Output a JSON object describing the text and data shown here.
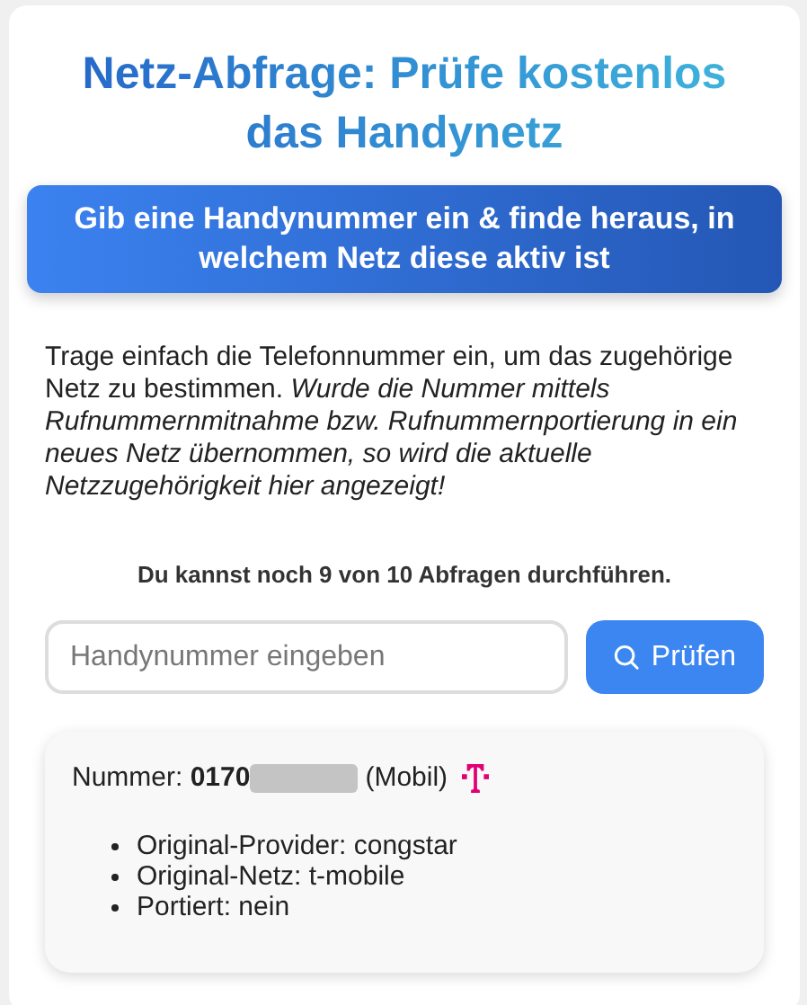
{
  "title": "Netz-Abfrage: Prüfe kostenlos das Handynetz",
  "banner": "Gib eine Handynummer ein & finde heraus, in welchem Netz diese aktiv ist",
  "intro": "Trage einfach die Telefonnummer ein, um das zugehörige Netz zu bestimmen. *Wurde die Nummer mittels Rufnummernmitnahme bzw. Rufnummernportierung in ein neues Netz übernommen, so wird die aktuelle Netzzugehörigkeit hier angezeigt!*",
  "quota": "Du kannst noch 9 von 10 Abfragen durchführen.",
  "search": {
    "placeholder": "Handynummer eingeben",
    "button": "Prüfen"
  },
  "result": {
    "label": "Nummer:",
    "number": "0170",
    "redacted": true,
    "type": "(Mobil)",
    "details": [
      "Original-Provider: congstar",
      "Original-Netz: t-mobile",
      "Portiert: nein"
    ]
  }
}
